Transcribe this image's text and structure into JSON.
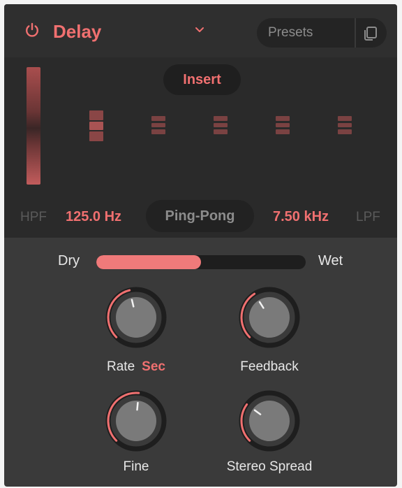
{
  "header": {
    "title": "Delay",
    "presets_label": "Presets"
  },
  "eq": {
    "insert_label": "Insert",
    "hpf_label": "HPF",
    "hpf_value": "125.0 Hz",
    "mode_label": "Ping-Pong",
    "lpf_value": "7.50 kHz",
    "lpf_label": "LPF"
  },
  "mix": {
    "dry_label": "Dry",
    "wet_label": "Wet",
    "level": 0.5
  },
  "knobs": {
    "rate": {
      "label": "Rate",
      "unit": "Sec",
      "value": 0.45
    },
    "feedback": {
      "label": "Feedback",
      "value": 0.38
    },
    "fine": {
      "label": "Fine",
      "value": 0.52
    },
    "stereo_spread": {
      "label": "Stereo Spread",
      "value": 0.3
    }
  },
  "colors": {
    "accent": "#f07070",
    "panel": "#3a3a3a",
    "header": "#2f2f2f",
    "eq_bg": "#2a2a2a",
    "knob_track": "#1e1e1e",
    "knob_face": "#7a7a7a"
  },
  "icons": {
    "power": "power-icon",
    "dropdown": "chevron-down-icon",
    "copy": "copy-icon"
  }
}
